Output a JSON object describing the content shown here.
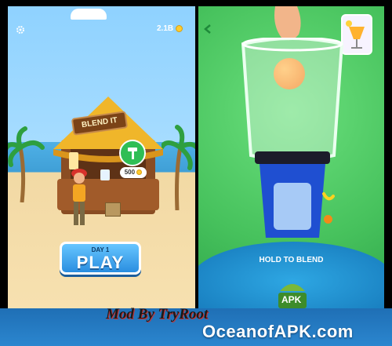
{
  "left_panel": {
    "coins": "2.1B",
    "sign_text": "BLEND IT",
    "unlock_cost": "500",
    "button": {
      "day_label": "DAY 1",
      "play_label": "PLAY"
    }
  },
  "right_panel": {
    "hold_label": "HOLD TO BLEND",
    "apk_label": "APK"
  },
  "watermark": {
    "mod_text": "Mod By TryRoot",
    "site_text": "OceanofAPK.com"
  },
  "colors": {
    "sky": "#8fd2ff",
    "sand": "#f7e1b0",
    "play_button": "#2a8ee0",
    "blend_bg": "#47c25d",
    "blender_blue": "#1f4fd1"
  }
}
